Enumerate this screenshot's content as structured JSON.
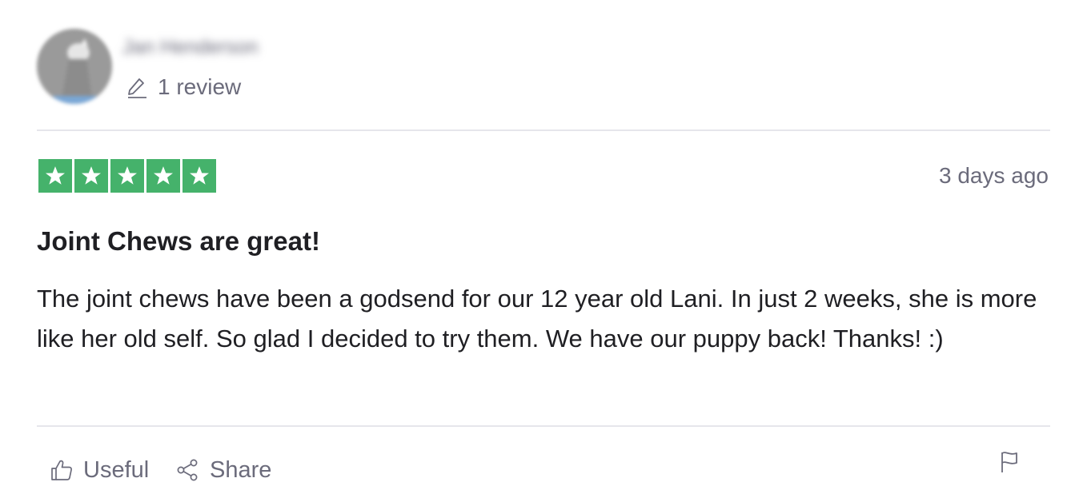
{
  "reviewer": {
    "name": "Jan Henderson",
    "review_count": "1 review",
    "avatar_icon": "avatar-photo"
  },
  "rating": {
    "stars": 5,
    "max_stars": 5,
    "color": "#45b26b",
    "date": "3 days ago"
  },
  "review": {
    "title": "Joint Chews are great!",
    "body": "The joint chews have been a godsend for our 12 year old Lani. In just 2 weeks, she is more like her old self. So glad I decided to try them. We have our puppy back! Thanks! :)"
  },
  "actions": {
    "useful_label": "Useful",
    "share_label": "Share",
    "useful_icon": "thumbs-up-icon",
    "share_icon": "share-icon",
    "report_icon": "flag-icon"
  },
  "colors": {
    "muted_text": "#6b6b7b",
    "primary_text": "#1f1f23",
    "divider": "#e6e6eb"
  }
}
